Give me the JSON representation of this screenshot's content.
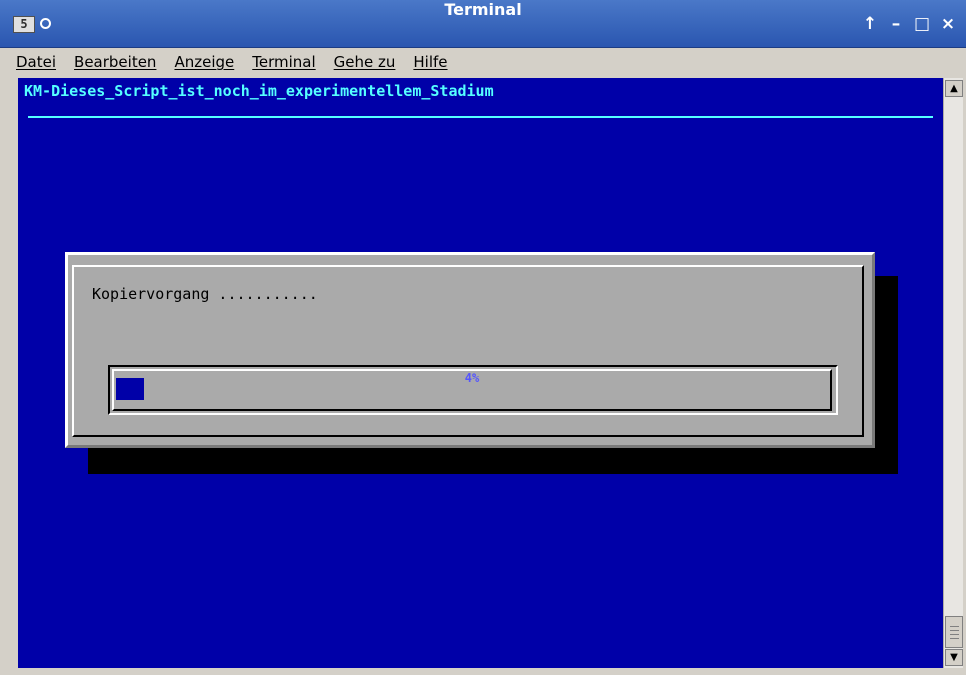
{
  "window": {
    "title": "Terminal",
    "app_icon_glyph": "5",
    "buttons": [
      "↑",
      "–",
      "□",
      "×"
    ]
  },
  "menubar": {
    "items": [
      "Datei",
      "Bearbeiten",
      "Anzeige",
      "Terminal",
      "Gehe zu",
      "Hilfe"
    ]
  },
  "terminal": {
    "header": "KM-Dieses_Script_ist_noch_im_experimentellem_Stadium",
    "dialog": {
      "message": "Kopiervorgang ...........",
      "progress_label": "4%",
      "progress_fraction": 0.04
    }
  },
  "scrollbar": {
    "up_icon": "▲",
    "down_icon": "▼"
  },
  "colors": {
    "terminal_bg": "#0000a8",
    "header_text": "#55ffff",
    "dialog_bg": "#aaaaaa",
    "progress_fill": "#0000a8",
    "progress_text": "#5555ff",
    "titlebar": "#2a56b0"
  }
}
